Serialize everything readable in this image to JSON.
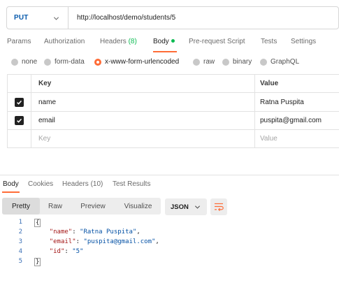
{
  "request": {
    "method": "PUT",
    "url": "http://localhost/demo/students/5"
  },
  "request_tabs": [
    {
      "label": "Params",
      "active": false
    },
    {
      "label": "Authorization",
      "active": false
    },
    {
      "label": "Headers",
      "count": "(8)",
      "active": false
    },
    {
      "label": "Body",
      "active": true
    },
    {
      "label": "Pre-request Script",
      "active": false
    },
    {
      "label": "Tests",
      "active": false
    },
    {
      "label": "Settings",
      "active": false
    }
  ],
  "body_types": [
    {
      "label": "none",
      "selected": false
    },
    {
      "label": "form-data",
      "selected": false
    },
    {
      "label": "x-www-form-urlencoded",
      "selected": true
    },
    {
      "label": "raw",
      "selected": false
    },
    {
      "label": "binary",
      "selected": false
    },
    {
      "label": "GraphQL",
      "selected": false
    }
  ],
  "params_table": {
    "columns": [
      "Key",
      "Value"
    ],
    "rows": [
      {
        "checked": true,
        "key": "name",
        "value": "Ratna Puspita"
      },
      {
        "checked": true,
        "key": "email",
        "value": "puspita@gmail.com"
      }
    ],
    "placeholder": {
      "key": "Key",
      "value": "Value"
    }
  },
  "response_tabs": [
    {
      "label": "Body",
      "active": true
    },
    {
      "label": "Cookies",
      "active": false
    },
    {
      "label": "Headers",
      "count": "(10)",
      "active": false
    },
    {
      "label": "Test Results",
      "active": false
    }
  ],
  "view_modes": [
    {
      "label": "Pretty",
      "active": true
    },
    {
      "label": "Raw",
      "active": false
    },
    {
      "label": "Preview",
      "active": false
    },
    {
      "label": "Visualize",
      "active": false
    }
  ],
  "format": "JSON",
  "response_body": {
    "line_numbers": [
      "1",
      "2",
      "3",
      "4",
      "5"
    ],
    "open_brace": "{",
    "close_brace": "}",
    "fields": [
      {
        "key": "\"name\"",
        "value": "\"Ratna Puspita\"",
        "sep": ","
      },
      {
        "key": "\"email\"",
        "value": "\"puspita@gmail.com\"",
        "sep": ","
      },
      {
        "key": "\"id\"",
        "value": "\"5\"",
        "sep": ""
      }
    ]
  },
  "colors": {
    "accent": "#ff6c37",
    "method": "#0b5cad",
    "success": "#0cbb52"
  }
}
